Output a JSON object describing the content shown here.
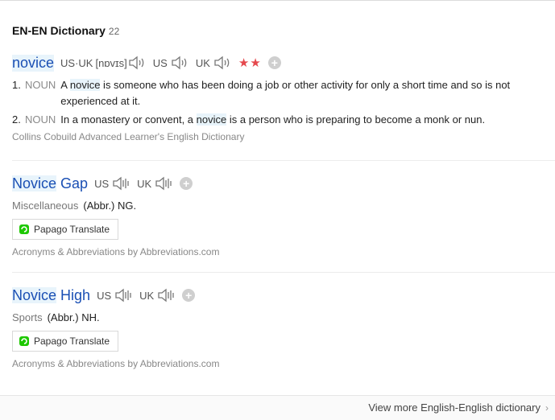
{
  "section": {
    "title": "EN-EN Dictionary",
    "count": "22"
  },
  "entry1": {
    "headword": "novice",
    "pron_label": "US·UK",
    "ipa": "[nɒvɪs]",
    "us_label": "US",
    "uk_label": "UK",
    "stars": "★★",
    "definitions": [
      {
        "num": "1.",
        "pos": "NOUN",
        "pre": "A ",
        "hl": "novice",
        "post": " is someone who has been doing a job or other activity for only a short time and so is not experienced at it."
      },
      {
        "num": "2.",
        "pos": "NOUN",
        "pre": "In a monastery or convent, a ",
        "hl": "novice",
        "post": " is a person who is preparing to become a monk or nun."
      }
    ],
    "source": "Collins Cobuild Advanced Learner's English Dictionary"
  },
  "entry2": {
    "head_hl": "Novice",
    "head_rest": " Gap",
    "us_label": "US",
    "uk_label": "UK",
    "category": "Miscellaneous",
    "meaning": "(Abbr.) NG.",
    "translate_label": "Papago Translate",
    "source": "Acronyms & Abbreviations by Abbreviations.com"
  },
  "entry3": {
    "head_hl": "Novice",
    "head_rest": " High",
    "us_label": "US",
    "uk_label": "UK",
    "category": "Sports",
    "meaning": "(Abbr.) NH.",
    "translate_label": "Papago Translate",
    "source": "Acronyms & Abbreviations by Abbreviations.com"
  },
  "footer": {
    "more_label": "View more English-English dictionary"
  },
  "colors": {
    "headword": "#1a4fb4",
    "stars": "#e5484d",
    "highlight": "#e8f4fb"
  }
}
